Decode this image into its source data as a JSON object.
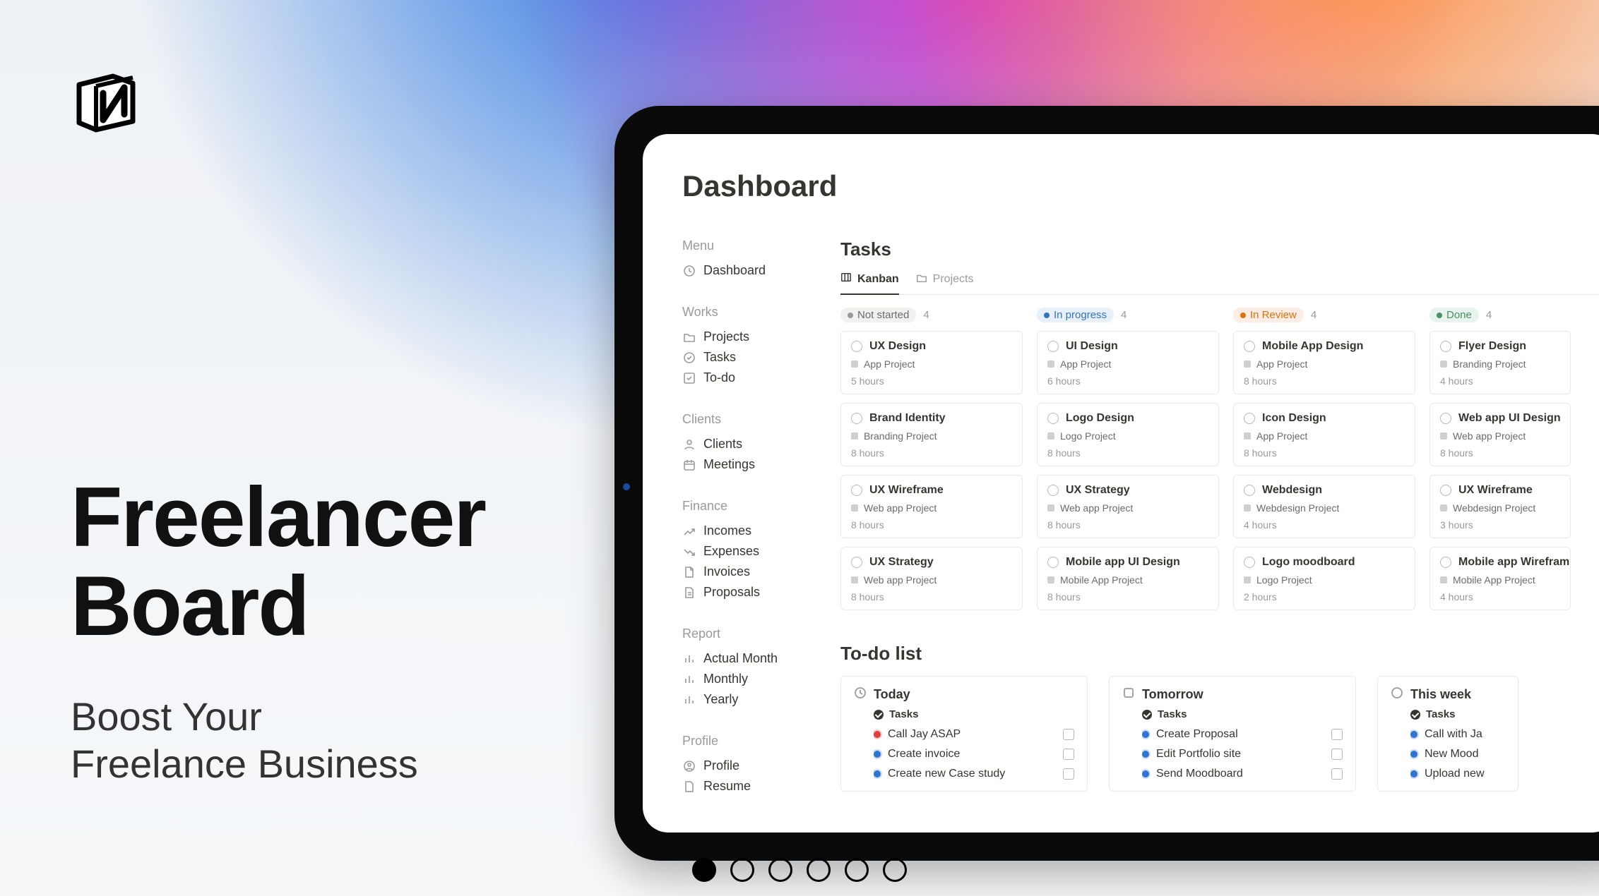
{
  "hero": {
    "title_line1": "Freelancer",
    "title_line2": "Board",
    "sub_line1": "Boost Your",
    "sub_line2": "Freelance Business"
  },
  "page_title": "Dashboard",
  "sidebar": {
    "groups": [
      {
        "label": "Menu",
        "items": [
          {
            "label": "Dashboard",
            "icon": "dashboard"
          }
        ]
      },
      {
        "label": "Works",
        "items": [
          {
            "label": "Projects",
            "icon": "folder"
          },
          {
            "label": "Tasks",
            "icon": "check-circle"
          },
          {
            "label": "To-do",
            "icon": "checkbox"
          }
        ]
      },
      {
        "label": "Clients",
        "items": [
          {
            "label": "Clients",
            "icon": "user"
          },
          {
            "label": "Meetings",
            "icon": "calendar"
          }
        ]
      },
      {
        "label": "Finance",
        "items": [
          {
            "label": "Incomes",
            "icon": "trend-up"
          },
          {
            "label": "Expenses",
            "icon": "trend-down"
          },
          {
            "label": "Invoices",
            "icon": "file"
          },
          {
            "label": "Proposals",
            "icon": "file-text"
          }
        ]
      },
      {
        "label": "Report",
        "items": [
          {
            "label": "Actual Month",
            "icon": "bar"
          },
          {
            "label": "Monthly",
            "icon": "bar"
          },
          {
            "label": "Yearly",
            "icon": "bar"
          }
        ]
      },
      {
        "label": "Profile",
        "items": [
          {
            "label": "Profile",
            "icon": "avatar"
          },
          {
            "label": "Resume",
            "icon": "doc"
          }
        ]
      }
    ]
  },
  "tasks": {
    "title": "Tasks",
    "tabs": [
      {
        "label": "Kanban",
        "icon": "board",
        "active": true
      },
      {
        "label": "Projects",
        "icon": "folder",
        "active": false
      }
    ],
    "columns": [
      {
        "label": "Not started",
        "pill": "gray",
        "count": 4,
        "cards": [
          {
            "title": "UX Design",
            "project": "App Project",
            "hours": "5 hours"
          },
          {
            "title": "Brand Identity",
            "project": "Branding Project",
            "hours": "8 hours"
          },
          {
            "title": "UX Wireframe",
            "project": "Web app Project",
            "hours": "8 hours"
          },
          {
            "title": "UX Strategy",
            "project": "Web app Project",
            "hours": "8 hours"
          }
        ]
      },
      {
        "label": "In progress",
        "pill": "blue",
        "count": 4,
        "cards": [
          {
            "title": "UI Design",
            "project": "App Project",
            "hours": "6 hours"
          },
          {
            "title": "Logo Design",
            "project": "Logo Project",
            "hours": "8 hours"
          },
          {
            "title": "UX Strategy",
            "project": "Web app Project",
            "hours": "8 hours"
          },
          {
            "title": "Mobile app UI Design",
            "project": "Mobile App Project",
            "hours": "8 hours"
          }
        ]
      },
      {
        "label": "In Review",
        "pill": "orange",
        "count": 4,
        "cards": [
          {
            "title": "Mobile App Design",
            "project": "App Project",
            "hours": "8 hours"
          },
          {
            "title": "Icon Design",
            "project": "App Project",
            "hours": "8 hours"
          },
          {
            "title": "Webdesign",
            "project": "Webdesign Project",
            "hours": "4 hours"
          },
          {
            "title": "Logo moodboard",
            "project": "Logo Project",
            "hours": "2 hours"
          }
        ]
      },
      {
        "label": "Done",
        "pill": "green",
        "count": 4,
        "cards": [
          {
            "title": "Flyer Design",
            "project": "Branding Project",
            "hours": "4 hours"
          },
          {
            "title": "Web app UI Design",
            "project": "Web app Project",
            "hours": "8 hours"
          },
          {
            "title": "UX Wireframe",
            "project": "Webdesign Project",
            "hours": "3 hours"
          },
          {
            "title": "Mobile app Wireframe",
            "project": "Mobile App Project",
            "hours": "4 hours"
          }
        ]
      }
    ]
  },
  "todo": {
    "title": "To-do list",
    "tasks_label": "Tasks",
    "columns": [
      {
        "label": "Today",
        "icon": "clock",
        "items": [
          {
            "text": "Call Jay ASAP",
            "color": "red"
          },
          {
            "text": "Create invoice",
            "color": "blue"
          },
          {
            "text": "Create new Case study",
            "color": "blue"
          }
        ]
      },
      {
        "label": "Tomorrow",
        "icon": "square",
        "items": [
          {
            "text": "Create Proposal",
            "color": "blue"
          },
          {
            "text": "Edit Portfolio site",
            "color": "blue"
          },
          {
            "text": "Send Moodboard",
            "color": "blue"
          }
        ]
      },
      {
        "label": "This week",
        "icon": "circle",
        "items": [
          {
            "text": "Call with Ja",
            "color": "blue"
          },
          {
            "text": "New Mood",
            "color": "blue"
          },
          {
            "text": "Upload new",
            "color": "blue"
          }
        ]
      }
    ]
  },
  "carousel": {
    "count": 6,
    "active": 0
  }
}
